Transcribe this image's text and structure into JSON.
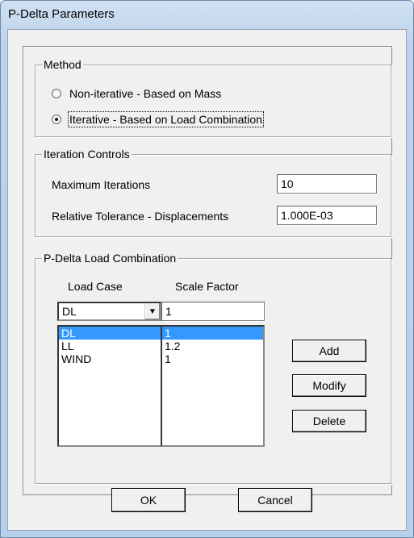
{
  "dialog": {
    "title": "P-Delta Parameters"
  },
  "method": {
    "group_label": "Method",
    "options": [
      {
        "label": "Non-iterative - Based on Mass",
        "selected": false
      },
      {
        "label": "Iterative - Based on Load Combination",
        "selected": true
      }
    ]
  },
  "iteration": {
    "group_label": "Iteration Controls",
    "max_label": "Maximum Iterations",
    "max_value": "10",
    "tol_label": "Relative Tolerance - Displacements",
    "tol_value": "1.000E-03"
  },
  "combo": {
    "group_label": "P-Delta Load Combination",
    "col_load_case": "Load Case",
    "col_scale": "Scale Factor",
    "load_case_selected": "DL",
    "scale_input": "1",
    "rows": [
      {
        "case": "DL",
        "factor": "1",
        "selected": true
      },
      {
        "case": "LL",
        "factor": "1.2",
        "selected": false
      },
      {
        "case": "WIND",
        "factor": "1",
        "selected": false
      }
    ],
    "add_label": "Add",
    "modify_label": "Modify",
    "delete_label": "Delete"
  },
  "footer": {
    "ok_label": "OK",
    "cancel_label": "Cancel"
  },
  "colors": {
    "selection": "#3399ff",
    "titlebar": "#bcd3ea"
  }
}
